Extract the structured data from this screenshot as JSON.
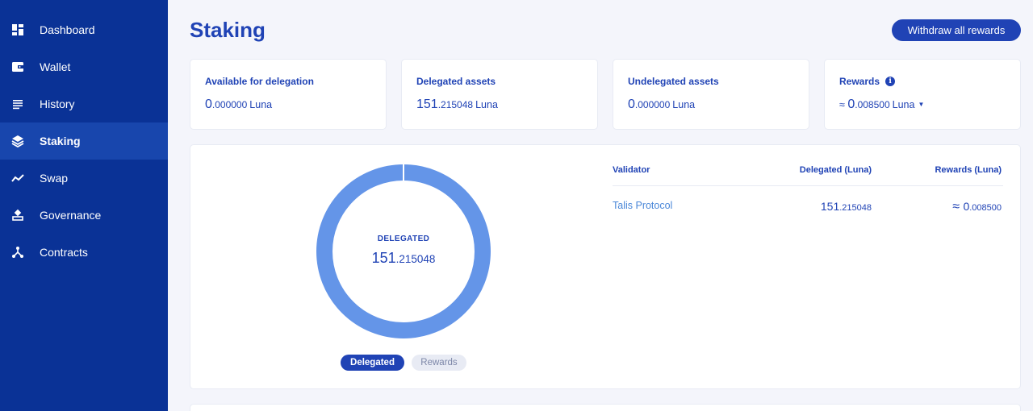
{
  "sidebar": {
    "items": [
      {
        "label": "Dashboard",
        "icon": "dashboard-icon",
        "active": false
      },
      {
        "label": "Wallet",
        "icon": "wallet-icon",
        "active": false
      },
      {
        "label": "History",
        "icon": "history-icon",
        "active": false
      },
      {
        "label": "Staking",
        "icon": "staking-icon",
        "active": true
      },
      {
        "label": "Swap",
        "icon": "swap-icon",
        "active": false
      },
      {
        "label": "Governance",
        "icon": "governance-icon",
        "active": false
      },
      {
        "label": "Contracts",
        "icon": "contracts-icon",
        "active": false
      }
    ]
  },
  "header": {
    "title": "Staking",
    "withdraw_label": "Withdraw all rewards"
  },
  "stats": [
    {
      "title": "Available for delegation",
      "int": "0",
      "dec": ".000000",
      "unit": "Luna"
    },
    {
      "title": "Delegated assets",
      "int": "151",
      "dec": ".215048",
      "unit": "Luna"
    },
    {
      "title": "Undelegated assets",
      "int": "0",
      "dec": ".000000",
      "unit": "Luna"
    },
    {
      "title": "Rewards",
      "prefix": "≈ ",
      "int": "0",
      "dec": ".008500",
      "unit": "Luna"
    }
  ],
  "donut": {
    "label": "DELEGATED",
    "int": "151",
    "dec": ".215048",
    "tabs": [
      "Delegated",
      "Rewards"
    ],
    "fraction": 1.0
  },
  "table": {
    "headers": [
      "Validator",
      "Delegated (Luna)",
      "Rewards (Luna)"
    ],
    "rows": [
      {
        "validator": "Talis Protocol",
        "delegated_int": "151",
        "delegated_dec": ".215048",
        "rewards_prefix": "≈ ",
        "rewards_int": "0",
        "rewards_dec": ".008500"
      }
    ]
  },
  "colors": {
    "sidebar_bg": "#0a3296",
    "sidebar_active": "#1846ad",
    "primary": "#2043b5",
    "donut": "#6495e8",
    "link": "#4a87d8",
    "background": "#f4f5fb"
  }
}
